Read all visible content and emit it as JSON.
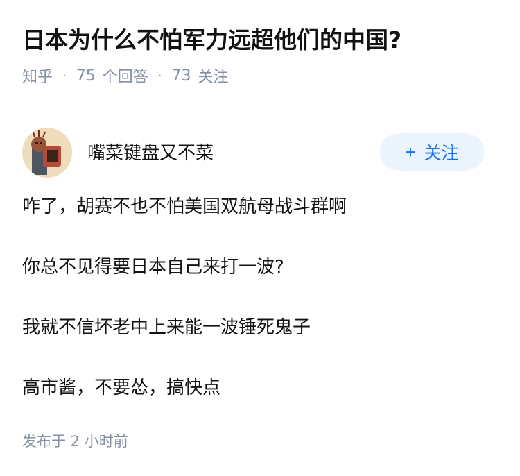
{
  "question": {
    "title": "日本为什么不怕军力远超他们的中国?",
    "source": "知乎",
    "answers_count": "75",
    "answers_label": "个回答",
    "followers_count": "73",
    "followers_label": "关注"
  },
  "answer": {
    "author_name": "嘴菜键盘又不菜",
    "follow_plus": "+",
    "follow_label": "关注",
    "paragraphs": [
      "咋了，胡赛不也不怕美国双航母战斗群啊",
      "你总不见得要日本自己来打一波?",
      "我就不信坏老中上来能一波锤死鬼子",
      "高市酱，不要怂，搞快点"
    ],
    "posted_time": "发布于  2 小时前"
  },
  "colors": {
    "title": "#121212",
    "meta": "#8590a6",
    "accent": "#1772f6",
    "follow_bg": "#ebf3fc"
  }
}
